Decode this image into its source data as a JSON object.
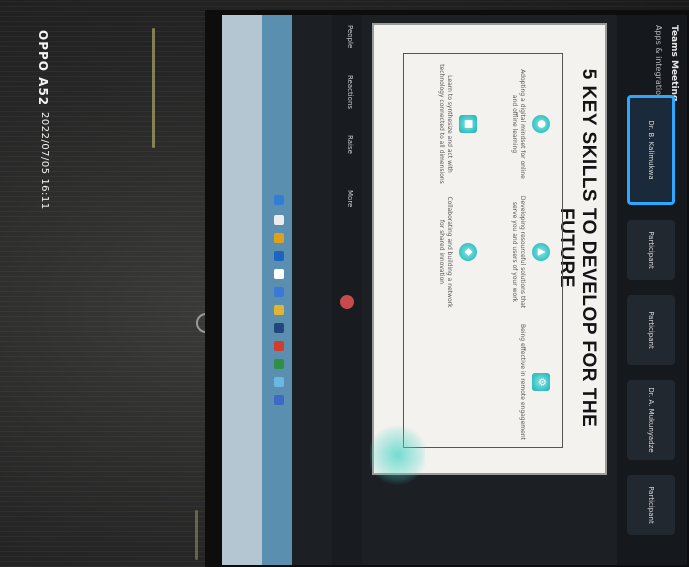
{
  "watermark": {
    "model": "OPPO A52",
    "stamp": "2022/07/05 16:11"
  },
  "slide": {
    "title": "5 KEY SKILLS TO DEVELOP FOR THE FUTURE",
    "skills": [
      {
        "icon": "person-icon",
        "text": "Adopting a digital mindset for online and offline learning"
      },
      {
        "icon": "chart-icon",
        "text": "Developing resourceful solutions that serve you and users of your work"
      },
      {
        "icon": "gear-icon",
        "text": "Being effective in remote engagement"
      },
      {
        "icon": "group-icon",
        "text": "Learn to synthesize and act with technology connected to all dimensions"
      },
      {
        "icon": "handshake-icon",
        "text": "Collaborating and building a network for shared innovation"
      }
    ],
    "accent_color": "#35c2c4"
  },
  "meeting": {
    "header_title": "Teams Meeting",
    "apps_label": "Apps & integrations",
    "participants": [
      "Dr. B. Kalimukwa",
      "Participant",
      "Participant",
      "Dr. A. Mukunyadze",
      "Participant"
    ],
    "controls": [
      "People",
      "Reactions",
      "Raise",
      "More"
    ]
  },
  "colors": {
    "taskbar": "#5b8fb0",
    "active_tile_border": "#2ea7ff"
  }
}
